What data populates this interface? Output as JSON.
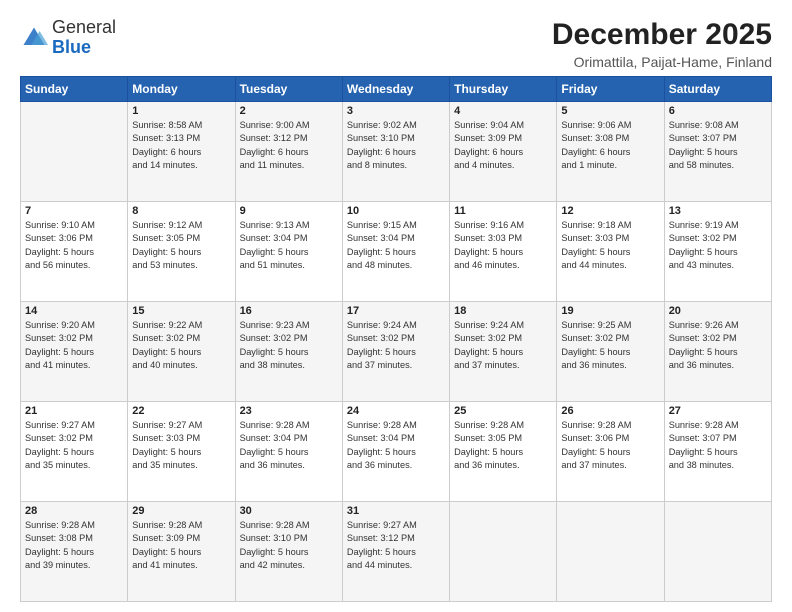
{
  "logo": {
    "general": "General",
    "blue": "Blue"
  },
  "title": "December 2025",
  "subtitle": "Orimattila, Paijat-Hame, Finland",
  "days_of_week": [
    "Sunday",
    "Monday",
    "Tuesday",
    "Wednesday",
    "Thursday",
    "Friday",
    "Saturday"
  ],
  "weeks": [
    [
      {
        "day": "",
        "info": ""
      },
      {
        "day": "1",
        "info": "Sunrise: 8:58 AM\nSunset: 3:13 PM\nDaylight: 6 hours\nand 14 minutes."
      },
      {
        "day": "2",
        "info": "Sunrise: 9:00 AM\nSunset: 3:12 PM\nDaylight: 6 hours\nand 11 minutes."
      },
      {
        "day": "3",
        "info": "Sunrise: 9:02 AM\nSunset: 3:10 PM\nDaylight: 6 hours\nand 8 minutes."
      },
      {
        "day": "4",
        "info": "Sunrise: 9:04 AM\nSunset: 3:09 PM\nDaylight: 6 hours\nand 4 minutes."
      },
      {
        "day": "5",
        "info": "Sunrise: 9:06 AM\nSunset: 3:08 PM\nDaylight: 6 hours\nand 1 minute."
      },
      {
        "day": "6",
        "info": "Sunrise: 9:08 AM\nSunset: 3:07 PM\nDaylight: 5 hours\nand 58 minutes."
      }
    ],
    [
      {
        "day": "7",
        "info": "Sunrise: 9:10 AM\nSunset: 3:06 PM\nDaylight: 5 hours\nand 56 minutes."
      },
      {
        "day": "8",
        "info": "Sunrise: 9:12 AM\nSunset: 3:05 PM\nDaylight: 5 hours\nand 53 minutes."
      },
      {
        "day": "9",
        "info": "Sunrise: 9:13 AM\nSunset: 3:04 PM\nDaylight: 5 hours\nand 51 minutes."
      },
      {
        "day": "10",
        "info": "Sunrise: 9:15 AM\nSunset: 3:04 PM\nDaylight: 5 hours\nand 48 minutes."
      },
      {
        "day": "11",
        "info": "Sunrise: 9:16 AM\nSunset: 3:03 PM\nDaylight: 5 hours\nand 46 minutes."
      },
      {
        "day": "12",
        "info": "Sunrise: 9:18 AM\nSunset: 3:03 PM\nDaylight: 5 hours\nand 44 minutes."
      },
      {
        "day": "13",
        "info": "Sunrise: 9:19 AM\nSunset: 3:02 PM\nDaylight: 5 hours\nand 43 minutes."
      }
    ],
    [
      {
        "day": "14",
        "info": "Sunrise: 9:20 AM\nSunset: 3:02 PM\nDaylight: 5 hours\nand 41 minutes."
      },
      {
        "day": "15",
        "info": "Sunrise: 9:22 AM\nSunset: 3:02 PM\nDaylight: 5 hours\nand 40 minutes."
      },
      {
        "day": "16",
        "info": "Sunrise: 9:23 AM\nSunset: 3:02 PM\nDaylight: 5 hours\nand 38 minutes."
      },
      {
        "day": "17",
        "info": "Sunrise: 9:24 AM\nSunset: 3:02 PM\nDaylight: 5 hours\nand 37 minutes."
      },
      {
        "day": "18",
        "info": "Sunrise: 9:24 AM\nSunset: 3:02 PM\nDaylight: 5 hours\nand 37 minutes."
      },
      {
        "day": "19",
        "info": "Sunrise: 9:25 AM\nSunset: 3:02 PM\nDaylight: 5 hours\nand 36 minutes."
      },
      {
        "day": "20",
        "info": "Sunrise: 9:26 AM\nSunset: 3:02 PM\nDaylight: 5 hours\nand 36 minutes."
      }
    ],
    [
      {
        "day": "21",
        "info": "Sunrise: 9:27 AM\nSunset: 3:02 PM\nDaylight: 5 hours\nand 35 minutes."
      },
      {
        "day": "22",
        "info": "Sunrise: 9:27 AM\nSunset: 3:03 PM\nDaylight: 5 hours\nand 35 minutes."
      },
      {
        "day": "23",
        "info": "Sunrise: 9:28 AM\nSunset: 3:04 PM\nDaylight: 5 hours\nand 36 minutes."
      },
      {
        "day": "24",
        "info": "Sunrise: 9:28 AM\nSunset: 3:04 PM\nDaylight: 5 hours\nand 36 minutes."
      },
      {
        "day": "25",
        "info": "Sunrise: 9:28 AM\nSunset: 3:05 PM\nDaylight: 5 hours\nand 36 minutes."
      },
      {
        "day": "26",
        "info": "Sunrise: 9:28 AM\nSunset: 3:06 PM\nDaylight: 5 hours\nand 37 minutes."
      },
      {
        "day": "27",
        "info": "Sunrise: 9:28 AM\nSunset: 3:07 PM\nDaylight: 5 hours\nand 38 minutes."
      }
    ],
    [
      {
        "day": "28",
        "info": "Sunrise: 9:28 AM\nSunset: 3:08 PM\nDaylight: 5 hours\nand 39 minutes."
      },
      {
        "day": "29",
        "info": "Sunrise: 9:28 AM\nSunset: 3:09 PM\nDaylight: 5 hours\nand 41 minutes."
      },
      {
        "day": "30",
        "info": "Sunrise: 9:28 AM\nSunset: 3:10 PM\nDaylight: 5 hours\nand 42 minutes."
      },
      {
        "day": "31",
        "info": "Sunrise: 9:27 AM\nSunset: 3:12 PM\nDaylight: 5 hours\nand 44 minutes."
      },
      {
        "day": "",
        "info": ""
      },
      {
        "day": "",
        "info": ""
      },
      {
        "day": "",
        "info": ""
      }
    ]
  ]
}
